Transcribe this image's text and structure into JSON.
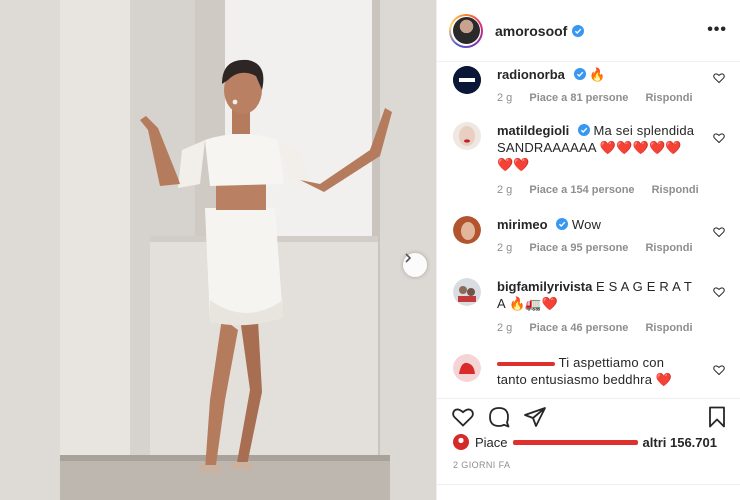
{
  "post": {
    "username": "amorosoof",
    "more_label": "•••"
  },
  "comments": [
    {
      "user": "radionorba",
      "text": "🔥",
      "age": "2 g",
      "likes": "Piace a 81 persone",
      "reply": "Rispondi"
    },
    {
      "user": "matildegioli",
      "text": "Ma sei splendida SANDRAAAAAA ❤️❤️❤️❤️❤️ ❤️❤️",
      "age": "2 g",
      "likes": "Piace a 154 persone",
      "reply": "Rispondi"
    },
    {
      "user": "mirimeo",
      "text": "Wow",
      "age": "2 g",
      "likes": "Piace a 95 persone",
      "reply": "Rispondi"
    },
    {
      "user": "bigfamilyrivista",
      "text": "E S A G E R A T A 🔥🚛❤️",
      "age": "2 g",
      "likes": "Piace a 46 persone",
      "reply": "Rispondi"
    },
    {
      "user": "",
      "text": "Ti aspettiamo con tanto entusiasmo beddhra ❤️"
    }
  ],
  "likes_summary": {
    "prefix": "Piace",
    "suffix": "altri 156.701"
  },
  "date_label": "2 GIORNI FA",
  "colors": {
    "verified": "#3897f0",
    "heart_red": "#ed4956",
    "text": "#262626",
    "muted": "#8e8e8e"
  }
}
